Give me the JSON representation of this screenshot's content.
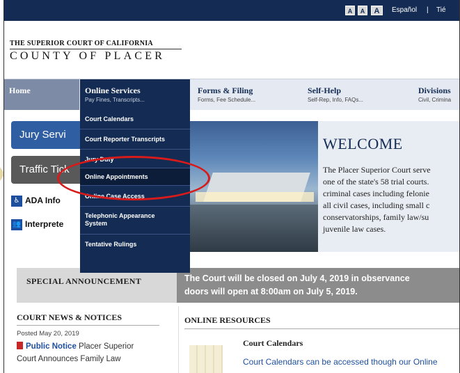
{
  "topbar": {
    "font_small": "A",
    "font_medium": "A",
    "font_large": "A",
    "lang_link": "Español",
    "separator": "|",
    "next_link": "Tié"
  },
  "logo": {
    "line1": "THE SUPERIOR COURT OF CALIFORNIA",
    "line2": "COUNTY OF PLACER"
  },
  "nav": {
    "items": [
      {
        "title": "Home",
        "sub": ""
      },
      {
        "title": "Online Services",
        "sub": "Pay Fines, Transcripts..."
      },
      {
        "title": "Forms & Filing",
        "sub": "Forms, Fee Schedule..."
      },
      {
        "title": "Self-Help",
        "sub": "Self-Rep, Info, FAQs..."
      },
      {
        "title": "Divisions",
        "sub": "Civil, Crimina"
      }
    ]
  },
  "dropdown": {
    "items": [
      "Court Calendars",
      "Court Reporter Transcripts",
      "Jury Duty",
      "Online Appointments",
      "Online Case Access",
      "Telephonic Appearance System",
      "Tentative Rulings"
    ],
    "active_index": 3
  },
  "sidebar": {
    "jury": "Jury Servi",
    "traffic": "Traffic Tick",
    "ada": "ADA Info",
    "interpreter": "Interprete",
    "ada_icon": "wheelchair-icon",
    "interpreter_icon": "people-icon"
  },
  "welcome": {
    "title": "WELCOME",
    "lines": [
      "The Placer Superior Court serve",
      "one of the state's 58 trial courts.",
      "criminal cases including felonie",
      "all civil cases, including small c",
      "conservatorships, family law/su",
      "juvenile law cases."
    ]
  },
  "announcement": {
    "label": "SPECIAL ANNOUNCEMENT",
    "line1": "The Court will be closed on July 4, 2019 in observance",
    "line2": "doors will open at 8:00am on July 5, 2019."
  },
  "news": {
    "title": "COURT NEWS & NOTICES",
    "date": "Posted May 20, 2019",
    "link": "Public Notice",
    "text1": " Placer Superior",
    "text2": "Court Announces Family Law"
  },
  "resources": {
    "title": "ONLINE RESOURCES",
    "item_title": "Court Calendars",
    "item_desc": "Court Calendars can be accessed though our Online"
  },
  "colors": {
    "navy": "#142c53",
    "highlight": "#d71a1a"
  }
}
